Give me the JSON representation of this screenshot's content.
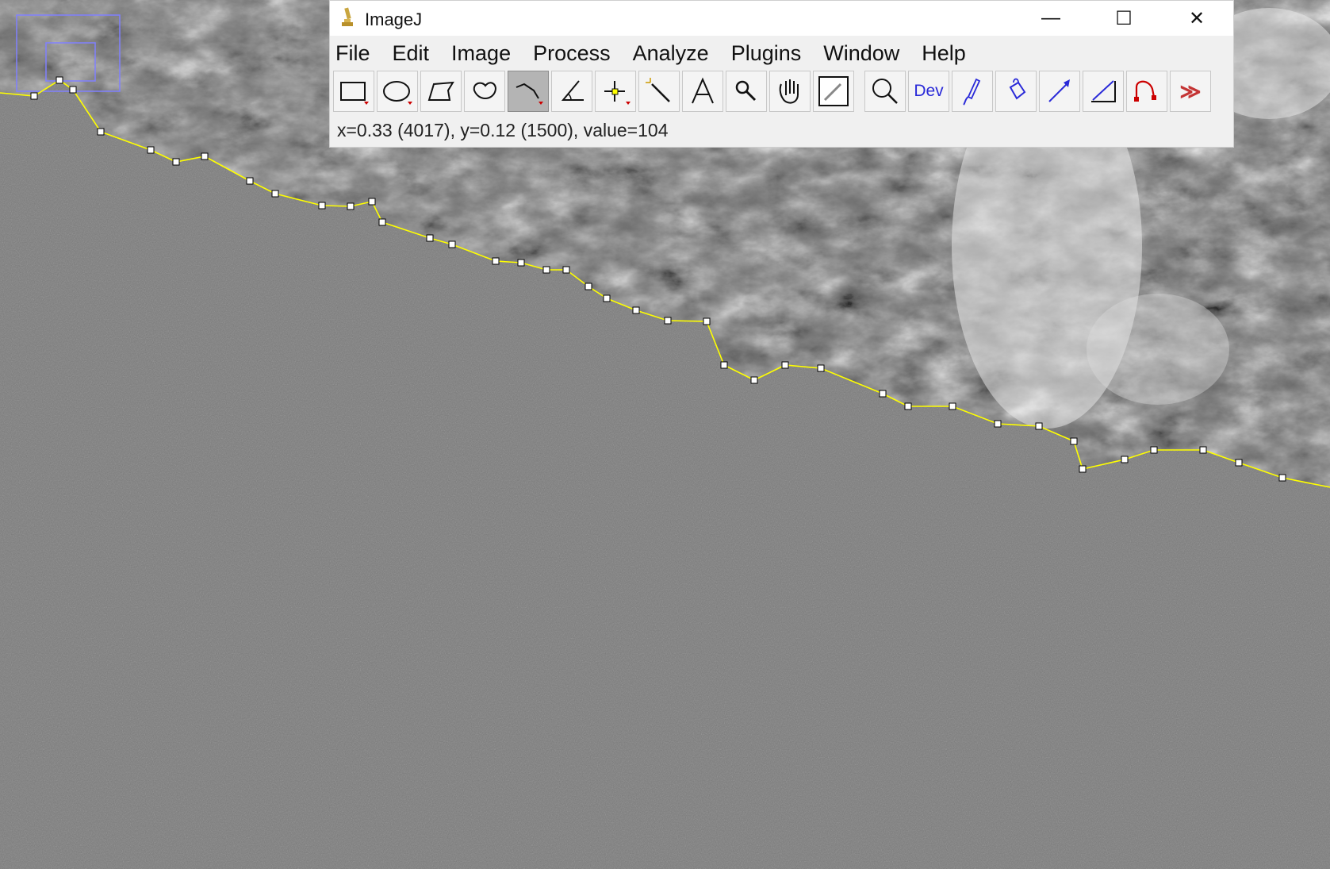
{
  "window": {
    "title": "ImageJ",
    "controls": {
      "minimize": "—",
      "maximize": "☐",
      "close": "✕"
    }
  },
  "menu": [
    "File",
    "Edit",
    "Image",
    "Process",
    "Analyze",
    "Plugins",
    "Window",
    "Help"
  ],
  "toolbar": {
    "selected_tool": "segmented-line",
    "tools": [
      {
        "name": "rectangle-tool-button"
      },
      {
        "name": "oval-tool-button"
      },
      {
        "name": "polygon-tool-button"
      },
      {
        "name": "freehand-tool-button"
      },
      {
        "name": "segmented-line-tool-button"
      },
      {
        "name": "angle-tool-button"
      },
      {
        "name": "point-tool-button"
      },
      {
        "name": "wand-tool-button"
      },
      {
        "name": "text-tool-button"
      },
      {
        "name": "magnifier-tool-button"
      },
      {
        "name": "hand-tool-button"
      },
      {
        "name": "color-picker-tool-button"
      },
      {
        "name": "zoom-tool-button"
      },
      {
        "name": "dev-tool-button"
      },
      {
        "name": "brush-tool-button"
      },
      {
        "name": "flood-fill-tool-button"
      },
      {
        "name": "arrow-tool-button"
      },
      {
        "name": "line-edit-tool-button"
      },
      {
        "name": "curve-tool-button"
      },
      {
        "name": "more-tools-button"
      }
    ],
    "dev_label": "Dev",
    "more_label": "≫"
  },
  "status": "x=0.33 (4017), y=0.12 (1500), value=104",
  "colors": {
    "line": "#ffff00",
    "handle_fill": "#ffffff",
    "handle_stroke": "#000000",
    "overview_box": "#8080ff",
    "water_gray": "#7b7b7b"
  }
}
